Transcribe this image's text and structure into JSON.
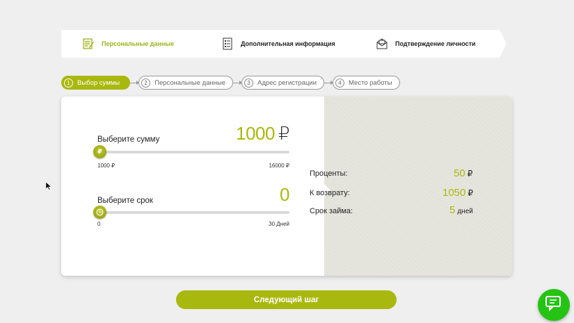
{
  "steps": [
    {
      "label": "Персональные данные",
      "icon": "form-edit-icon",
      "active": true
    },
    {
      "label": "Дополнительная информация",
      "icon": "document-list-icon",
      "active": false
    },
    {
      "label": "Подтверждение личности",
      "icon": "envelope-icon",
      "active": false
    }
  ],
  "substeps": [
    {
      "num": "1",
      "label": "Выбор суммы",
      "active": true
    },
    {
      "num": "2",
      "label": "Персональные данные",
      "active": false
    },
    {
      "num": "3",
      "label": "Адрес регистрации",
      "active": false
    },
    {
      "num": "4",
      "label": "Место работы",
      "active": false
    }
  ],
  "amount": {
    "label": "Выберите сумму",
    "value": "1000",
    "currency": "₽",
    "thumb": "₽",
    "min": "1000 ₽",
    "max": "16000 ₽",
    "level": 0
  },
  "term": {
    "label": "Выберите срок",
    "value": "0",
    "min": "0",
    "max": "30 Дней",
    "level": 0
  },
  "summary": {
    "interest_label": "Проценты:",
    "interest_value": "50",
    "interest_unit": "₽",
    "return_label": "К возврату:",
    "return_value": "1050",
    "return_unit": "₽",
    "term_label": "Срок займа:",
    "term_value": "5",
    "term_unit": "дней"
  },
  "next_button": "Следующий шаг",
  "colors": {
    "accent": "#a9b80e",
    "chat": "#25c414",
    "panel": "#e2e2da"
  }
}
